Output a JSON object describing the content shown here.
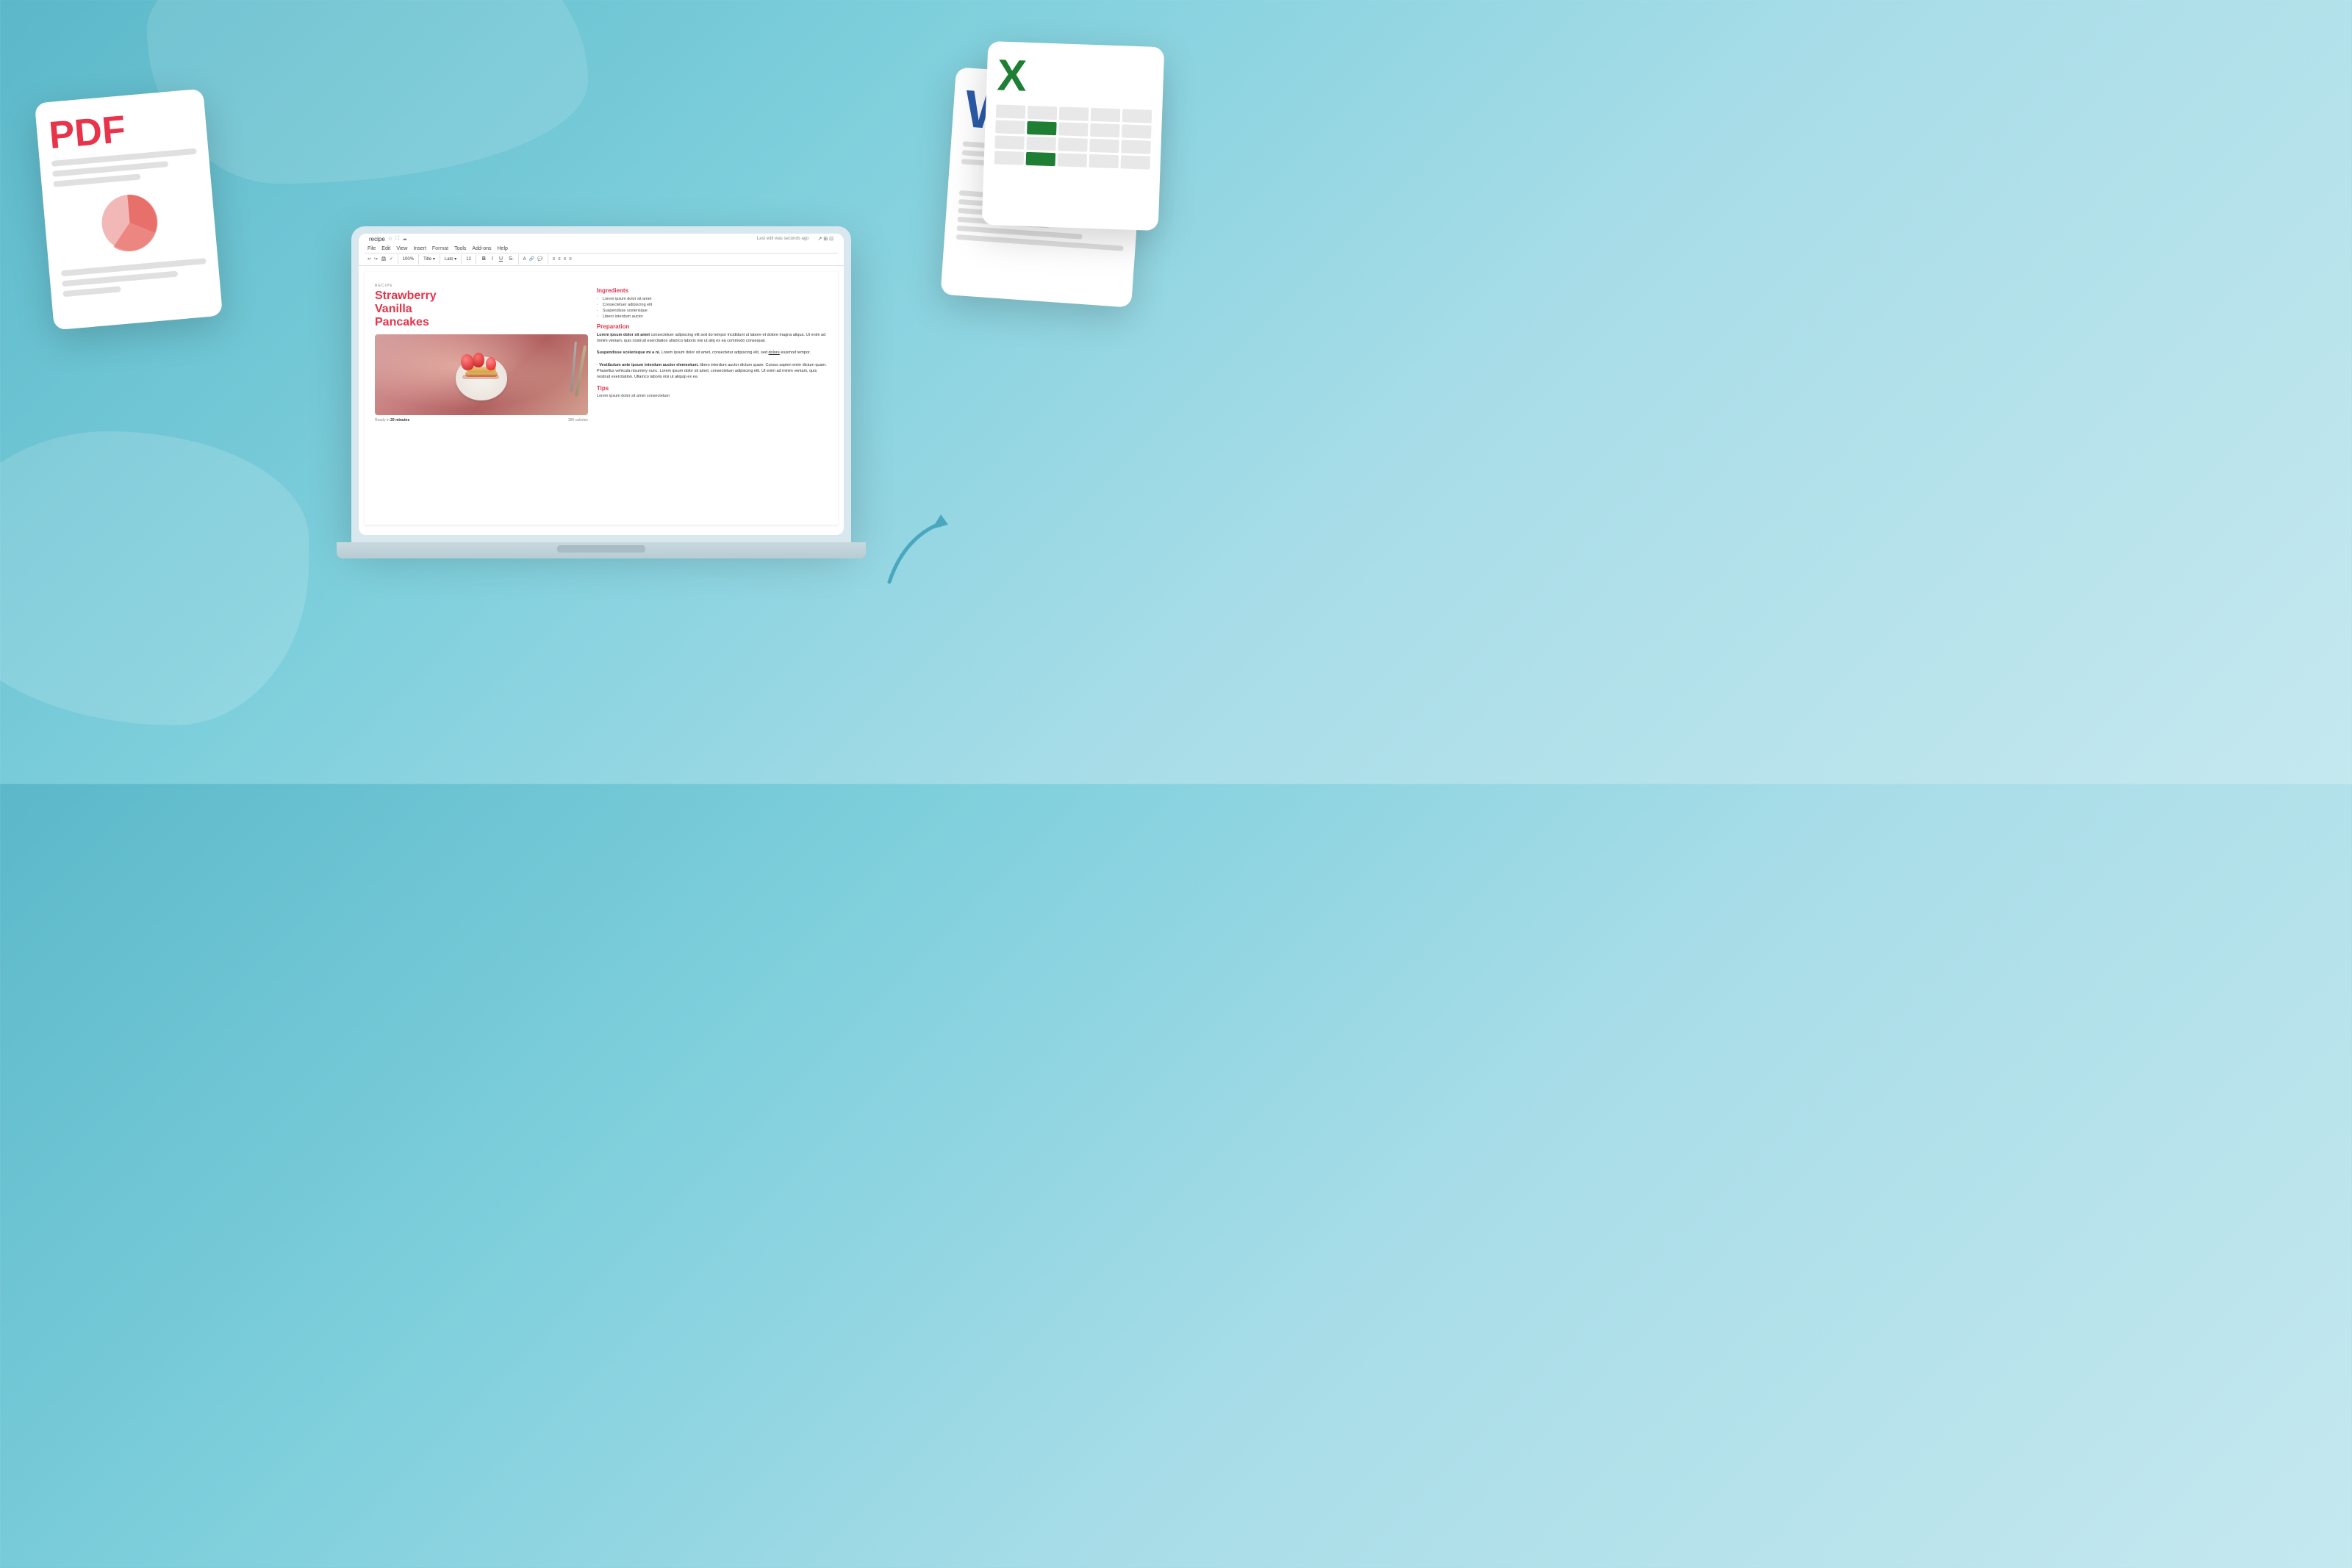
{
  "background": {
    "color_start": "#5bb8c9",
    "color_end": "#c5e8ef"
  },
  "pdf_card": {
    "label": "PDF",
    "lines": [
      "long",
      "medium",
      "short",
      "long",
      "medium",
      "xshort"
    ],
    "chart_alt": "Pie chart"
  },
  "word_card": {
    "logo": "W",
    "lines": [
      "long",
      "medium",
      "short",
      "long",
      "medium",
      "long",
      "short"
    ]
  },
  "excel_card": {
    "logo": "X",
    "grid_rows": 4,
    "grid_cols": 5
  },
  "laptop": {
    "screen_alt": "Google Docs with recipe document"
  },
  "google_docs": {
    "file_name": "recipe",
    "menu_items": [
      "File",
      "Edit",
      "View",
      "Insert",
      "Format",
      "Tools",
      "Add-ons",
      "Help"
    ],
    "last_edit": "Last edit was seconds ago",
    "format_label": "Format",
    "toolbar_items": [
      "100%",
      "Lato",
      "12",
      "B",
      "I",
      "U",
      "A",
      "Title"
    ],
    "document": {
      "recipe_label": "RECIPE",
      "title_line1": "Strawberry",
      "title_line2": "Vanilla",
      "title_line3": "Pancakes",
      "ingredients_heading": "Ingredients",
      "ingredients": [
        "Lorem ipsum dolor sit amet",
        "Consectetuer adipiscing elit",
        "Suspendisse scelerisque",
        "Libero interdum auctor"
      ],
      "preparation_heading": "Preparation",
      "preparation_text": "Lorem ipsum dolor sit amet consectetuer adipiscing elit sed do tempor incididunt ut labore et dolore magna aliqua. Ut enim ad minim veniam, quis nostrud exercitation ullamco laboris nisi ut aliq ex ea commodo consequat. Suspendisse scelerisque mi a ni. Lorem ipsum dolor sit amet, consectetur adipiscing elit, sed dolore eiusmod tempor. Vestibulum ante ipsum interdum auctor elementum. libero interdum auctor dictum quam. Cursus sapien enim dictum quam. Phasellus vehicula nisummy nunc. Lorem ipsum dolor sit amet, consectetuer adipiscing elit. Ut enim ad minim veniam, quis nostrud exercitation. Ullamco laboris nisi ut aliquip ex ea",
      "ready_in_label": "Ready in",
      "ready_in_time": "20 minutes",
      "calories_label": "280 calories",
      "tips_heading": "Tips",
      "tips_text": "Lorem ipsum dolor sit amet consectetuer"
    }
  },
  "arrow": {
    "direction": "up-right",
    "color": "#4aa8be"
  }
}
